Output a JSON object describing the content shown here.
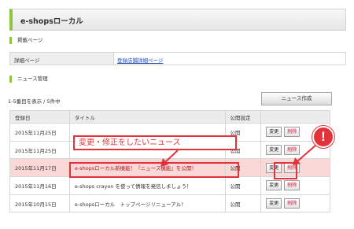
{
  "header": {
    "title": "e-shopsローカル"
  },
  "listing": {
    "section_label": "掲載ページ",
    "row_label": "詳細ページ",
    "link_text": "登録店舗詳細ページ"
  },
  "news": {
    "section_label": "ニュース管理",
    "count_text": "1-5番目を表示 / 5件中",
    "create_button": "ニュース作成",
    "columns": [
      "登録日",
      "タイトル",
      "公開設定",
      ""
    ],
    "rows": [
      {
        "date": "2015年11月25日",
        "title": "",
        "status": "公開",
        "edit": "変更",
        "delete": "削除"
      },
      {
        "date": "2015年11月25日",
        "title": "",
        "status": "公開",
        "edit": "変更",
        "delete": "削除"
      },
      {
        "date": "2015年11月17日",
        "title": "e-shopsローカル新機能！『ニュース機能』を公開！",
        "status": "公開",
        "edit": "変更",
        "delete": "削除"
      },
      {
        "date": "2015年11月16日",
        "title": "e-shops crayon を使って情報を発信しましょう！",
        "status": "公開",
        "edit": "変更",
        "delete": "削除"
      },
      {
        "date": "2015年10月15日",
        "title": "e-shopsローカル　トップページリニューアル！",
        "status": "公開",
        "edit": "変更",
        "delete": "削除"
      }
    ]
  },
  "annotation": {
    "callout_text": "変更・修正をしたいニュース",
    "badge_text": "!",
    "color": "#e3333a"
  }
}
